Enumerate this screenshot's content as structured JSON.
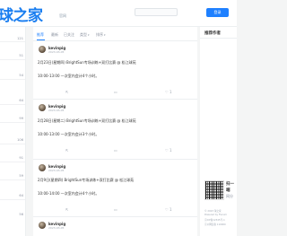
{
  "header": {
    "logo": "球之家",
    "logo_tag": "官网",
    "join_button": "登录"
  },
  "leftrail": {
    "numbers": [
      "121",
      "51",
      "54",
      "64",
      "99",
      "106",
      "91",
      "59",
      "64",
      "56"
    ]
  },
  "tabs": [
    {
      "label": "推荐"
    },
    {
      "label": "最新"
    },
    {
      "label": "已关注"
    },
    {
      "label": "类型"
    },
    {
      "label": "排序"
    }
  ],
  "posts": [
    {
      "user": "kevinpig",
      "time": "2023-03-05",
      "line1": "2月23日(星期四) BrightSun专场训练+双打比赛 @ 松江球苑",
      "line2": "10:00-13:00 一次室内会计4个小时。",
      "comments": "",
      "likes": "1"
    },
    {
      "user": "kevinpig",
      "time": "2023-03-05",
      "line1": "2月28日(星期二) BrightSun专场训练+双打比赛 @ 松江球苑",
      "line2": "10:00-13:00 一次室内会计3个小时。",
      "comments": "",
      "likes": "1"
    },
    {
      "user": "kevinpig",
      "time": "2023-03-05",
      "line1": "2月9日(星期四) BrightSun专场训练+双打比赛 @ 松江球苑",
      "line2": "10:00-14:00 一次室内会计4个小时。",
      "comments": "",
      "likes": "1"
    },
    {
      "user": "kevinpig",
      "time": "2023-03-05",
      "line1": "",
      "line2": "",
      "comments": "",
      "likes": ""
    }
  ],
  "sidebar": {
    "title": "推荐作者",
    "qr_line1": "扫一",
    "qr_line2": "端",
    "qr_sub": "网分",
    "footer": [
      "© 2023 球之家",
      "Powered by Flarum",
      "京ICP备12345号-1",
      "京公网安备 110000"
    ]
  }
}
